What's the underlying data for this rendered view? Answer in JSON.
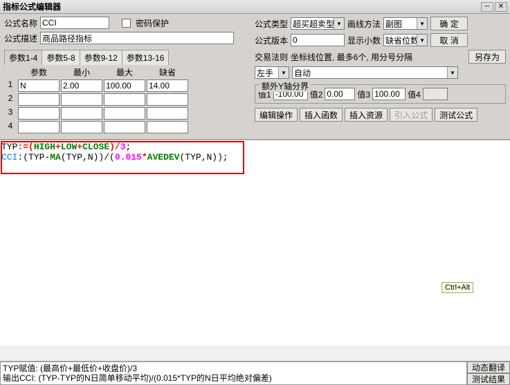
{
  "window": {
    "title": "指标公式编辑器"
  },
  "labels": {
    "formula_name": "公式名称",
    "formula_desc": "公式描述",
    "pwd_protect": "密码保护",
    "formula_type": "公式类型",
    "draw_method": "画线方法",
    "formula_version": "公式版本",
    "show_decimals": "显示小数",
    "trade_rule": "交易法则",
    "coord_hint": "坐标线位置, 最多6个, 用分号分隔",
    "extra_y": "额外Y轴分界"
  },
  "fields": {
    "name": "CCI",
    "desc": "商品路径指标",
    "type": "超买超卖型",
    "draw": "副图",
    "version": "0",
    "decimals": "缺省位数",
    "trade_left": "左手",
    "trade_right": "自动"
  },
  "buttons": {
    "ok": "确  定",
    "cancel": "取  消",
    "save_as": "另存为",
    "edit_op": "编辑操作",
    "insert_fn": "插入函数",
    "insert_res": "插入资源",
    "import_formula": "引入公式",
    "test": "测试公式",
    "dyn_translate": "动态翻译",
    "test_result": "测试结果"
  },
  "tabs": {
    "t1": "参数1-4",
    "t2": "参数5-8",
    "t3": "参数9-12",
    "t4": "参数13-16"
  },
  "param_headers": {
    "name": "参数",
    "min": "最小",
    "max": "最大",
    "def": "缺省"
  },
  "params": [
    {
      "n": "1",
      "name": "N",
      "min": "2.00",
      "max": "100.00",
      "def": "14.00"
    },
    {
      "n": "2",
      "name": "",
      "min": "",
      "max": "",
      "def": ""
    },
    {
      "n": "3",
      "name": "",
      "min": "",
      "max": "",
      "def": ""
    },
    {
      "n": "4",
      "name": "",
      "min": "",
      "max": "",
      "def": ""
    }
  ],
  "yaxis": {
    "v1l": "值1",
    "v1": "-100.00",
    "v2l": "值2",
    "v2": "0.00",
    "v3l": "值3",
    "v3": "100.00",
    "v4l": "值4",
    "v4": ""
  },
  "code": {
    "line1_1": "TYP",
    "line1_2": ":=(",
    "line1_3": "HIGH",
    "line1_4": "+",
    "line1_5": "LOW",
    "line1_6": "+",
    "line1_7": "CLOSE",
    "line1_8": ")/",
    "line1_9": "3",
    "line1_10": ";",
    "line2_1": "CCI",
    "line2_2": ":(TYP-",
    "line2_3": "MA",
    "line2_4": "(TYP,N))/(",
    "line2_5": "0.015",
    "line2_6": "*",
    "line2_7": "AVEDEV",
    "line2_8": "(TYP,N));"
  },
  "tooltip": "Ctrl+Alt",
  "status": {
    "l1": "TYP赋值: (最高价+最低价+收盘价)/3",
    "l2": "输出CCI: (TYP-TYP的N日简单移动平均)/(0.015*TYP的N日平均绝对偏差)"
  }
}
